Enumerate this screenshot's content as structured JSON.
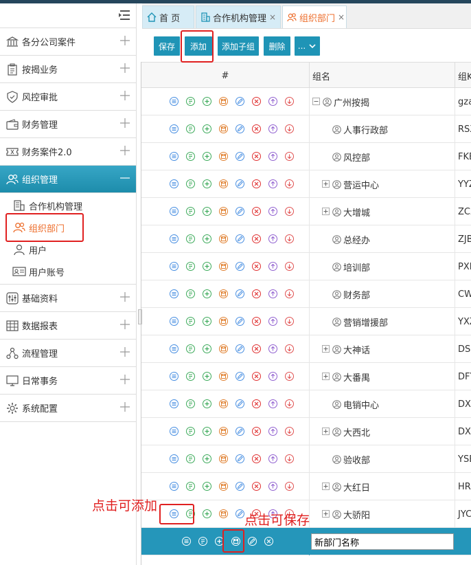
{
  "sidebar": {
    "items": [
      {
        "label": "各分公司案件",
        "icon": "bank-icon"
      },
      {
        "label": "按揭业务",
        "icon": "clipboard-icon"
      },
      {
        "label": "风控审批",
        "icon": "shield-icon"
      },
      {
        "label": "财务管理",
        "icon": "wallet-icon"
      },
      {
        "label": "财务案件2.0",
        "icon": "ticket-icon"
      },
      {
        "label": "组织管理",
        "icon": "users-icon"
      },
      {
        "label": "基础资料",
        "icon": "sliders-icon"
      },
      {
        "label": "数据报表",
        "icon": "table-icon"
      },
      {
        "label": "流程管理",
        "icon": "flow-icon"
      },
      {
        "label": "日常事务",
        "icon": "monitor-icon"
      },
      {
        "label": "系统配置",
        "icon": "gear-icon"
      }
    ],
    "subitems": [
      {
        "label": "合作机构管理",
        "icon": "building-icon"
      },
      {
        "label": "组织部门",
        "icon": "users-icon"
      },
      {
        "label": "用户",
        "icon": "user-icon"
      },
      {
        "label": "用户账号",
        "icon": "id-card-icon"
      }
    ]
  },
  "tabs": [
    {
      "label": "首 页",
      "closable": false
    },
    {
      "label": "合作机构管理",
      "closable": true
    },
    {
      "label": "组织部门",
      "closable": true
    }
  ],
  "toolbar": {
    "save": "保存",
    "add": "添加",
    "add_child": "添加子组",
    "delete": "删除",
    "more": "..."
  },
  "grid": {
    "headers": [
      "#",
      "组名",
      "组K"
    ],
    "rows": [
      {
        "name": "广州按揭",
        "code": "gza",
        "level": 0,
        "expander": "minus"
      },
      {
        "name": "人事行政部",
        "code": "RSX",
        "level": 1,
        "expander": "none"
      },
      {
        "name": "风控部",
        "code": "FKB",
        "level": 1,
        "expander": "none"
      },
      {
        "name": "营运中心",
        "code": "YYZ",
        "level": 1,
        "expander": "plus"
      },
      {
        "name": "大增城",
        "code": "ZCX",
        "level": 1,
        "expander": "plus"
      },
      {
        "name": "总经办",
        "code": "ZJB",
        "level": 1,
        "expander": "none"
      },
      {
        "name": "培训部",
        "code": "PXB",
        "level": 1,
        "expander": "none"
      },
      {
        "name": "财务部",
        "code": "CW",
        "level": 1,
        "expander": "none"
      },
      {
        "name": "营销增援部",
        "code": "YXZ",
        "level": 1,
        "expander": "none"
      },
      {
        "name": "大神话",
        "code": "DSH",
        "level": 1,
        "expander": "plus"
      },
      {
        "name": "大番禺",
        "code": "DFY",
        "level": 1,
        "expander": "plus"
      },
      {
        "name": "电销中心",
        "code": "DXZ",
        "level": 1,
        "expander": "none"
      },
      {
        "name": "大西北",
        "code": "DXB",
        "level": 1,
        "expander": "plus"
      },
      {
        "name": "验收部",
        "code": "YSB",
        "level": 1,
        "expander": "none"
      },
      {
        "name": "大红日",
        "code": "HRC",
        "level": 1,
        "expander": "plus"
      },
      {
        "name": "大骄阳",
        "code": "JYC",
        "level": 1,
        "expander": "plus"
      }
    ],
    "row_action_icons": [
      "detail-icon",
      "edit-list-icon",
      "add-icon",
      "save-icon",
      "edit-icon",
      "cancel-icon",
      "upload-icon",
      "download-icon"
    ],
    "editing_row": {
      "value": "新部门名称",
      "icons": [
        "detail-icon",
        "edit-list-icon",
        "add-icon",
        "save-icon",
        "edit-icon",
        "cancel-icon"
      ]
    }
  },
  "annotations": {
    "add_hint": "点击可添加",
    "save_hint": "点击可保存"
  },
  "colors": {
    "accent": "#1f94b6",
    "active_tab": "#ed6d2b",
    "annotation": "#e02020"
  }
}
